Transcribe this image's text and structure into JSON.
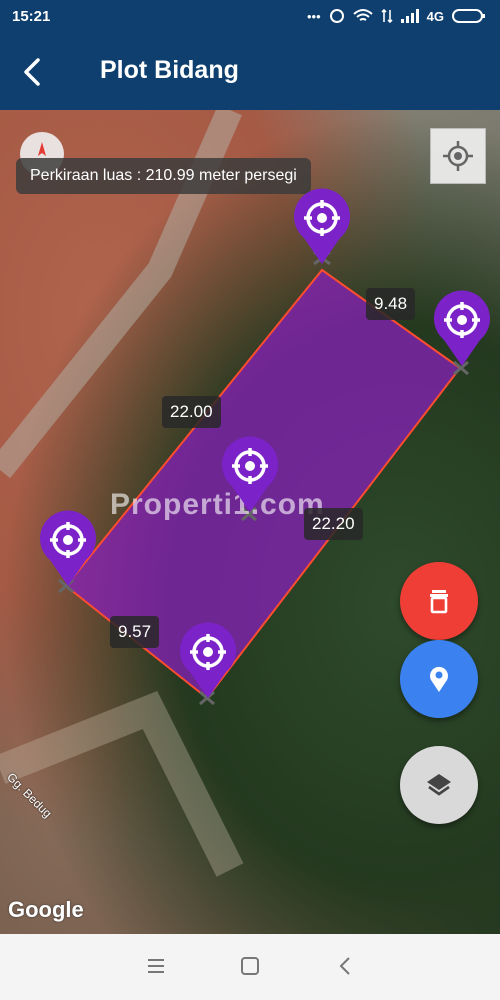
{
  "status_bar": {
    "time": "15:21",
    "dots": "•••",
    "network": "4G"
  },
  "app_bar": {
    "title": "Plot Bidang",
    "back_icon": "back-arrow-icon"
  },
  "map": {
    "area_estimate": "Perkiraan luas : 210.99 meter persegi",
    "distances": [
      "9.48",
      "22.00",
      "22.20",
      "9.57"
    ],
    "watermark": "Properti1.com",
    "street_label": "Gg. Bedug",
    "attribution": "Google",
    "polygon_fill": "#8a1fbf",
    "polygon_stroke": "#ff4d2e",
    "pin_color": "#7b22c9",
    "pin_icon": "crosshair-icon"
  },
  "actions": {
    "delete_color": "#ef3e36",
    "marker_color": "#3b82f0",
    "layers_color": "#d9d9d9"
  },
  "nav_bar": {
    "items": [
      "menu-icon",
      "home-square-icon",
      "back-chevron-icon"
    ]
  }
}
